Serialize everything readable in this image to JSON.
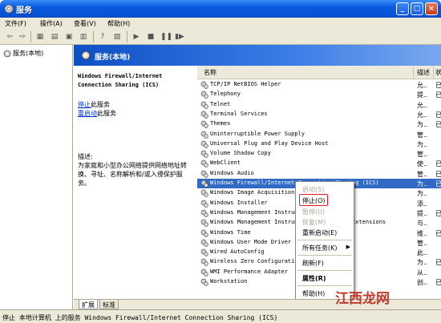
{
  "window": {
    "title": "服务"
  },
  "menu": [
    "文件(F)",
    "操作(A)",
    "查看(V)",
    "帮助(H)"
  ],
  "toolbar_icons": [
    "back-arrow",
    "forward-arrow",
    "console-tree",
    "properties",
    "refresh",
    "export",
    "help",
    "mmc-view",
    "play",
    "stop",
    "pause",
    "restart"
  ],
  "tree": {
    "root": "服务(本地)"
  },
  "pane": {
    "title": "服务(本地)"
  },
  "detail": {
    "service_name_line1": "Windows Firewall/Internet",
    "service_name_line2": "Connection Sharing (ICS)",
    "stop_link": "停止",
    "stop_suffix": "此服务",
    "restart_link": "重启动",
    "restart_suffix": "此服务",
    "desc_label": "描述:",
    "desc_text": "为家庭和小型办公网络提供网络地址转换、寻址、名称解析和/或入侵保护服务。"
  },
  "columns": {
    "name": "名称",
    "description": "描述",
    "status": "状"
  },
  "rows": [
    {
      "name": "TCP/IP NetBIOS Helper",
      "desc": "允..",
      "status": "已"
    },
    {
      "name": "Telephony",
      "desc": "提..",
      "status": "已"
    },
    {
      "name": "Telnet",
      "desc": "允..",
      "status": ""
    },
    {
      "name": "Terminal Services",
      "desc": "允..",
      "status": "已"
    },
    {
      "name": "Themes",
      "desc": "为..",
      "status": "已"
    },
    {
      "name": "Uninterruptible Power Supply",
      "desc": "管..",
      "status": ""
    },
    {
      "name": "Universal Plug and Play Device Host",
      "desc": "为..",
      "status": ""
    },
    {
      "name": "Volume Shadow Copy",
      "desc": "管..",
      "status": ""
    },
    {
      "name": "WebClient",
      "desc": "使..",
      "status": "已"
    },
    {
      "name": "Windows Audio",
      "desc": "管..",
      "status": "已"
    },
    {
      "name": "Windows Firewall/Internet Connection Sharing (ICS)",
      "desc": "为..",
      "status": "已"
    },
    {
      "name": "Windows Image Acquisition (WIA)",
      "desc": "为..",
      "status": ""
    },
    {
      "name": "Windows Installer",
      "desc": "添..",
      "status": ""
    },
    {
      "name": "Windows Management Instrumentation",
      "desc": "提..",
      "status": "已"
    },
    {
      "name": "Windows Management Instrumentation Driver Extensions",
      "desc": "与..",
      "status": ""
    },
    {
      "name": "Windows Time",
      "desc": "维..",
      "status": "已"
    },
    {
      "name": "Windows User Mode Driver Framework",
      "desc": "管..",
      "status": ""
    },
    {
      "name": "Wired AutoConfig",
      "desc": "此..",
      "status": ""
    },
    {
      "name": "Wireless Zero Configuration",
      "desc": "为..",
      "status": "已"
    },
    {
      "name": "WMI Performance Adapter",
      "desc": "从..",
      "status": ""
    },
    {
      "name": "Workstation",
      "desc": "创..",
      "status": "已"
    }
  ],
  "context_menu": {
    "start": "启动(S)",
    "stop": "停止(O)",
    "pause": "暂停(U)",
    "resume": "恢复(M)",
    "restart": "重新启动(E)",
    "all_tasks": "所有任务(K)",
    "refresh": "刷新(F)",
    "properties": "属性(R)",
    "help": "帮助(H)"
  },
  "tabs": [
    "扩展",
    "标准"
  ],
  "status": {
    "text": "停止 本地计算机 上的服务 Windows Firewall/Internet Connection Sharing (ICS)"
  },
  "watermark": "江西龙网",
  "colors": {
    "titlebar": "#0553d6",
    "selection": "#316ac5",
    "highlight_box": "#e02020",
    "header": "#0e4fc6"
  }
}
